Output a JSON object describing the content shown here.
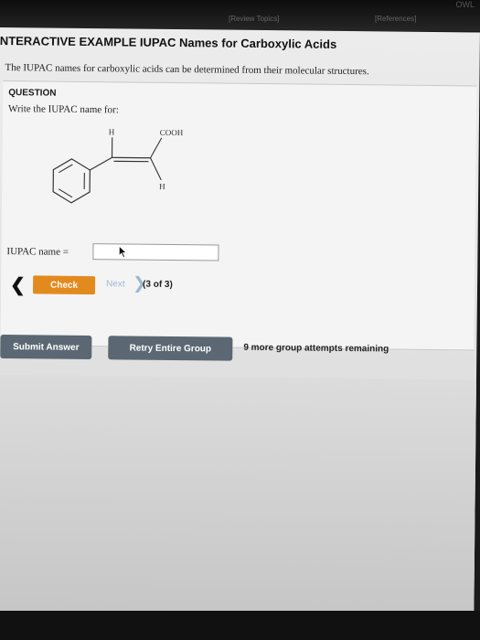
{
  "topbar": {
    "review_topics": "[Review Topics]",
    "references": "[References]",
    "owl": "OWL"
  },
  "header": {
    "title": "NTERACTIVE EXAMPLE  IUPAC Names for Carboxylic Acids"
  },
  "intro_text": "The IUPAC names for carboxylic acids can be determined from their molecular structures.",
  "question": {
    "label": "QUESTION",
    "prompt": "Write the IUPAC name for:",
    "atoms": {
      "h_top": "H",
      "cooh": "COOH",
      "h_bottom": "H"
    }
  },
  "answer": {
    "label": "IUPAC name =",
    "value": "",
    "placeholder": ""
  },
  "nav": {
    "back_glyph": "❮",
    "check_label": "Check",
    "next_label": "Next",
    "next_glyph": "❯",
    "count": "(3 of 3)"
  },
  "actions": {
    "submit_label": "Submit Answer",
    "retry_label": "Retry Entire Group",
    "attempts_text": "9 more group attempts remaining"
  },
  "colors": {
    "check": "#e38a1e",
    "action_buttons": "#5b6873"
  }
}
